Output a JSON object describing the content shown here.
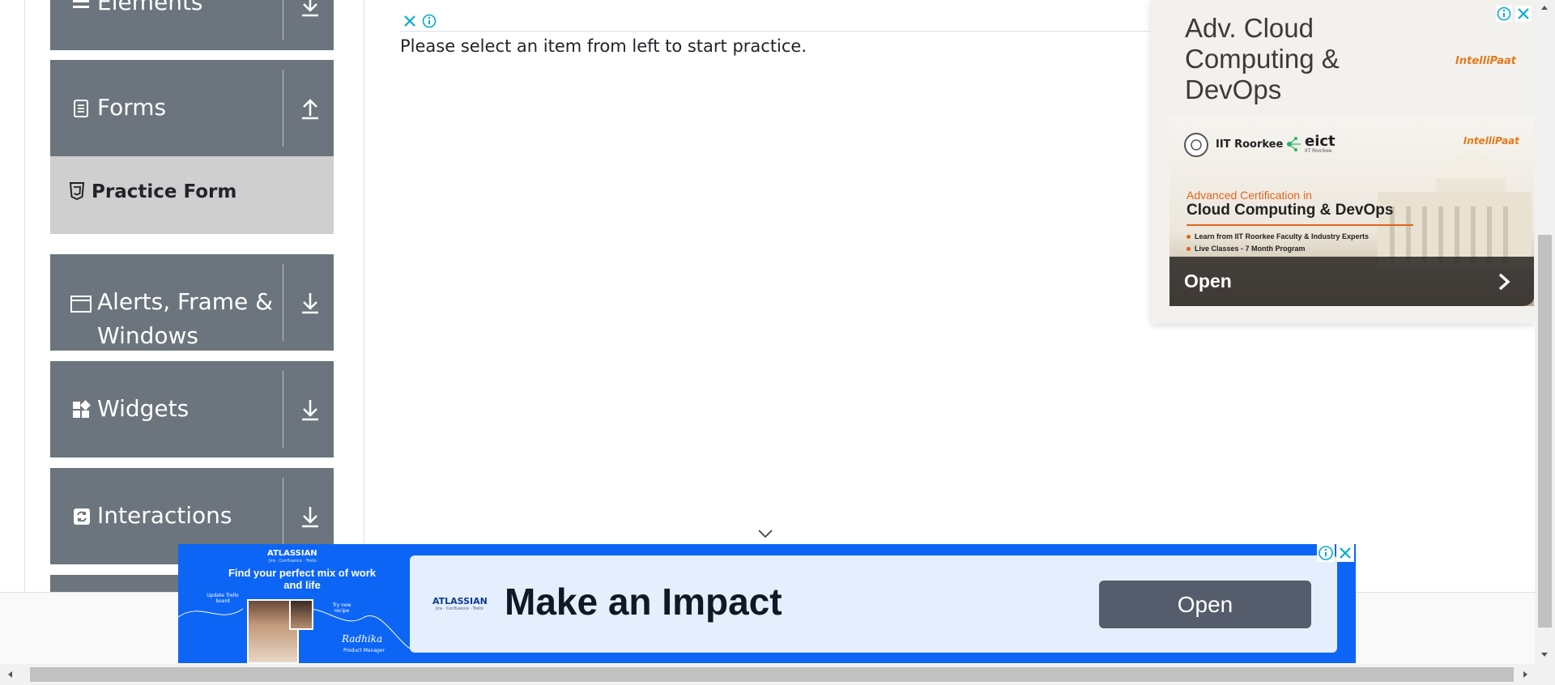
{
  "sidebar": {
    "groups": [
      {
        "label": "Elements",
        "icon": "menu-icon",
        "arrow": "arrow-down-icon"
      },
      {
        "label": "Forms",
        "icon": "document-icon",
        "arrow": "arrow-up-icon"
      },
      {
        "label": "Alerts, Frame &",
        "label2": "Windows",
        "icon": "window-icon",
        "arrow": "arrow-down-icon"
      },
      {
        "label": "Widgets",
        "icon": "widgets-icon",
        "arrow": "arrow-down-icon"
      },
      {
        "label": "Interactions",
        "icon": "interactions-icon",
        "arrow": "arrow-down-icon"
      }
    ],
    "active_item": {
      "label": "Practice Form",
      "icon": "html5-icon"
    }
  },
  "main": {
    "message": "Please select an item from left to start practice."
  },
  "ad_right": {
    "headline": "Adv. Cloud Computing & DevOps",
    "brand": "IntelliPaat",
    "partner1": "IIT Roorkee",
    "partner2": "eict",
    "partner2_sub": "IIT Roorkee",
    "cert_line1": "Advanced Certification in",
    "cert_line2": "Cloud Computing & DevOps",
    "bullet1": "Learn from IIT Roorkee Faculty & Industry Experts",
    "bullet2": "Live Classes - 7 Month Program",
    "open_label": "Open"
  },
  "ad_bottom": {
    "brand": "ATLASSIAN",
    "brand_sub": "Jira · Confluence · Trello",
    "tagline": "Find your perfect mix of work and life",
    "update_note": "Update Trello board",
    "try_note": "Try new recipe",
    "signature": "Radhika",
    "role": "Product Manager",
    "headline": "Make an Impact",
    "open_label": "Open"
  },
  "colors": {
    "sidebar_group_bg": "#6c757d",
    "active_item_bg": "#cfcfcf",
    "ad_blue": "#0d65f6",
    "ad_control": "#00aecd"
  }
}
